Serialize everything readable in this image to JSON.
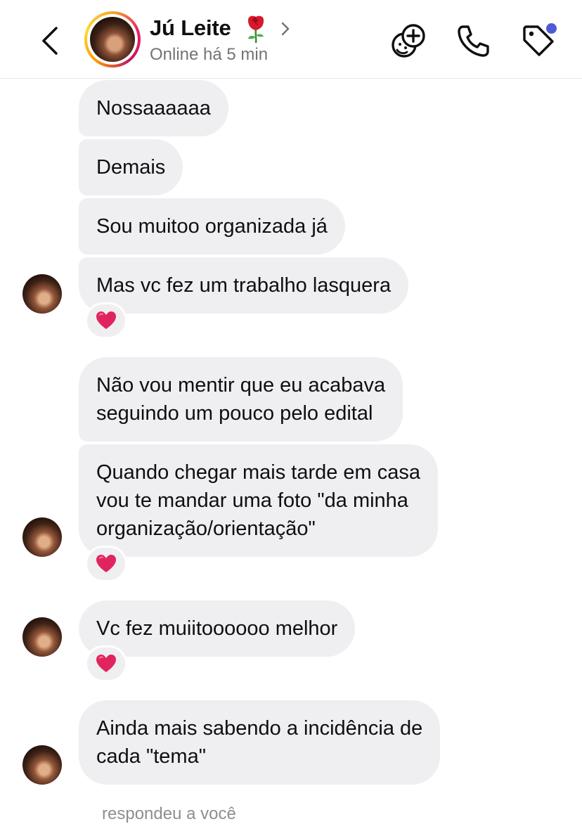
{
  "header": {
    "name": "Jú Leite",
    "status": "Online há 5 min"
  },
  "messages": [
    {
      "text": "Nossaaaaaa",
      "reaction": ""
    },
    {
      "text": "Demais",
      "reaction": ""
    },
    {
      "text": "Sou muitoo organizada já",
      "reaction": ""
    },
    {
      "text": "Mas vc fez um trabalho lasquera",
      "reaction": "heart"
    },
    {
      "text": "Não vou mentir que eu acabava\nseguindo um pouco pelo edital",
      "reaction": ""
    },
    {
      "text": "Quando chegar mais tarde em casa\nvou te mandar uma foto \"da minha\norganização/orientação\"",
      "reaction": "heart"
    },
    {
      "text": "Vc fez muiitoooooo melhor",
      "reaction": "heart"
    },
    {
      "text": "Ainda mais sabendo a incidência de\ncada \"tema\"",
      "reaction": ""
    }
  ],
  "footer_partial_text": "respondeu a você",
  "colors": {
    "bubble": "#efeff2",
    "status_text": "#737373",
    "notification_dot": "#4f5bd5",
    "heart": "#e0245e"
  },
  "icons": [
    "back-chevron-icon",
    "rose-icon",
    "chevron-right-icon",
    "sticker-add-icon",
    "phone-icon",
    "tag-icon",
    "heart-icon"
  ]
}
